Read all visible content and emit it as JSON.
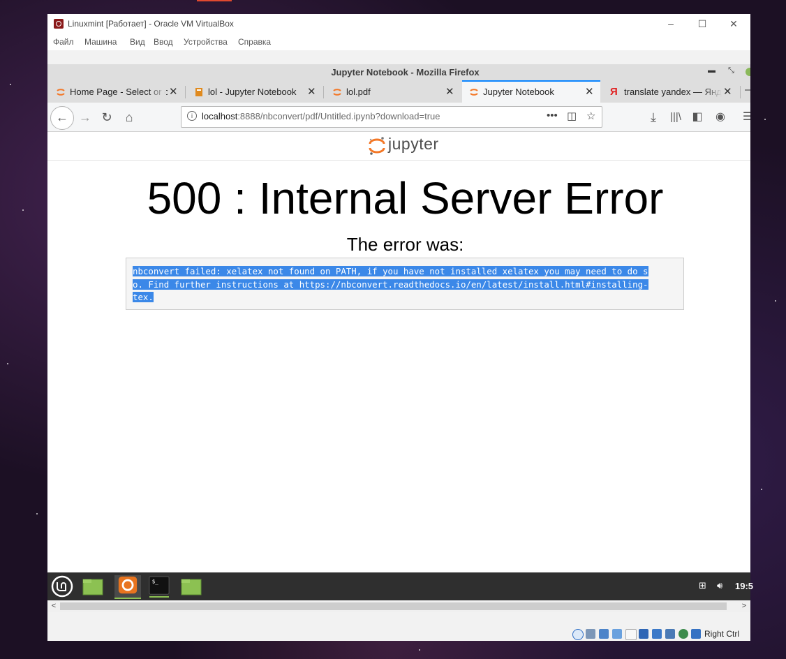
{
  "vbox": {
    "title": "Linuxmint [Работает] - Oracle VM VirtualBox",
    "menu": [
      "Файл",
      "Машина",
      "Вид",
      "Ввод",
      "Устройства",
      "Справка"
    ],
    "host_key": "Right Ctrl"
  },
  "firefox": {
    "window_title": "Jupyter Notebook - Mozilla Firefox",
    "tabs": [
      {
        "label": "Home Page - Select or create a notebook",
        "icon": "jupyter-icon",
        "active": false
      },
      {
        "label": "lol - Jupyter Notebook",
        "icon": "notebook-icon",
        "active": false
      },
      {
        "label": "lol.pdf",
        "icon": "jupyter-icon",
        "active": false
      },
      {
        "label": "Jupyter Notebook",
        "icon": "jupyter-icon",
        "active": true
      },
      {
        "label": "translate yandex — Яндекс",
        "icon": "yandex-icon",
        "active": false
      }
    ],
    "url": {
      "host": "localhost",
      "rest": ":8888/nbconvert/pdf/Untitled.ipynb?download=true"
    }
  },
  "page": {
    "brand": "jupyter",
    "heading": "500 : Internal Server Error",
    "subheading": "The error was:",
    "error_lines": [
      "nbconvert failed: xelatex not found on PATH, if you have not installed xelatex you may need to do s",
      "o. Find further instructions at https://nbconvert.readthedocs.io/en/latest/install.html#installing-",
      "tex."
    ]
  },
  "taskbar": {
    "clock": "19:5"
  },
  "colors": {
    "selection": "#3b88e8",
    "tab_accent": "#0a84ff",
    "jupyter_orange": "#f37726",
    "mint_green": "#8cc152"
  }
}
